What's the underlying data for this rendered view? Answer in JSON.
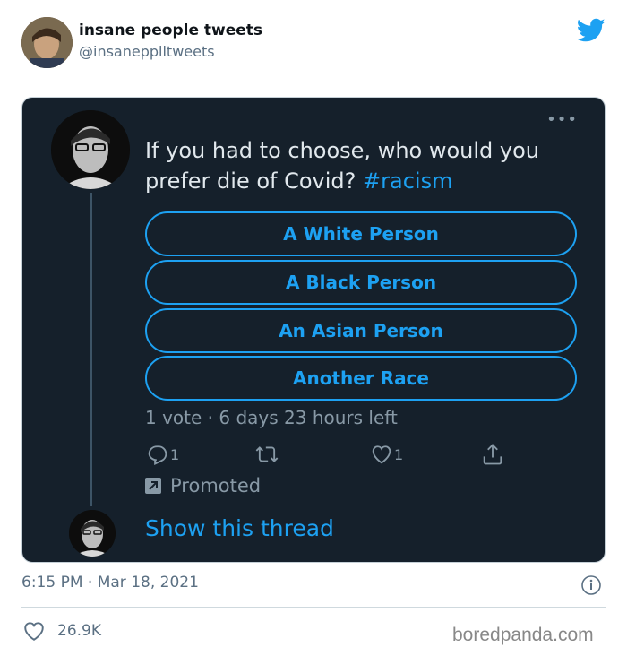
{
  "outer_tweet": {
    "display_name": "insane people tweets",
    "handle": "@insanepplltweets",
    "timestamp": "6:15 PM · Mar 18, 2021",
    "likes": "26.9K"
  },
  "inner_tweet": {
    "question_text": "If you had to choose, who would you prefer die of Covid? ",
    "hashtag": "#racism",
    "poll_options": [
      "A White Person",
      "A Black Person",
      "An Asian Person",
      "Another Race"
    ],
    "poll_meta": "1 vote · 6 days 23 hours left",
    "reply_count": "1",
    "like_count": "1",
    "promoted_label": "Promoted",
    "show_thread_label": "Show this thread"
  },
  "watermark": "boredpanda.com",
  "colors": {
    "accent": "#1da1f2",
    "dark_bg": "#15202b",
    "muted": "#8899a6",
    "outer_muted": "#5b7083"
  }
}
